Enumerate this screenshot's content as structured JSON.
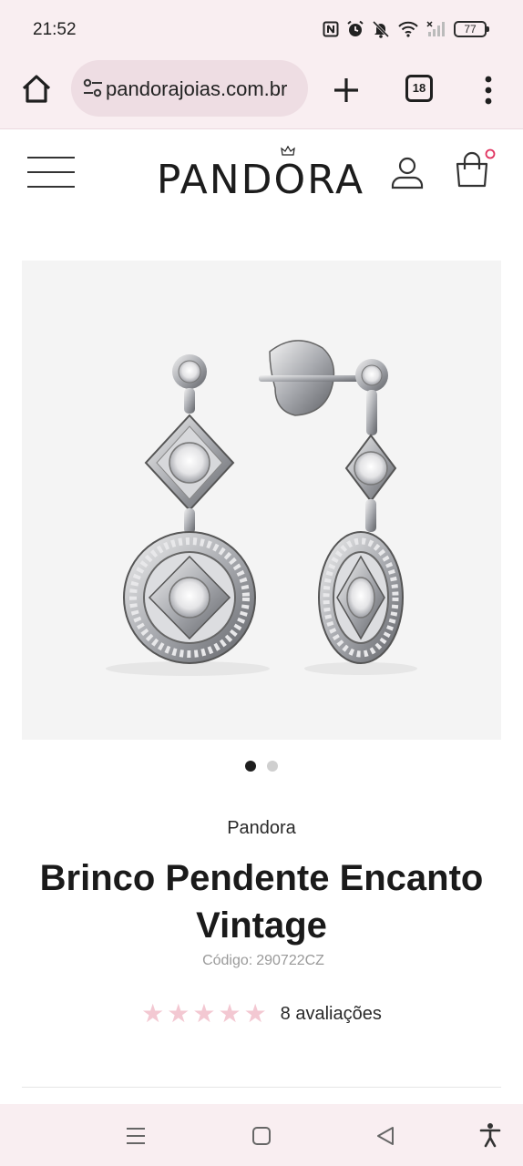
{
  "status_bar": {
    "time": "21:52",
    "battery": "77",
    "icons": [
      "nfc-icon",
      "alarm-icon",
      "mute-icon",
      "wifi-icon",
      "signal-icon",
      "battery-icon"
    ]
  },
  "browser": {
    "url": "pandorajoias.com.br",
    "tab_count": "18",
    "icons": [
      "home-icon",
      "site-settings-icon",
      "new-tab-icon",
      "tabs-icon",
      "more-vert-icon"
    ]
  },
  "site_header": {
    "logo": "PANDORA",
    "icons": [
      "hamburger-icon",
      "crown-icon",
      "account-icon",
      "cart-icon"
    ]
  },
  "product": {
    "brand": "Pandora",
    "title": "Brinco Pendente Encanto Vintage",
    "code_label": "Código:",
    "code": "290722CZ",
    "rating_value": 5,
    "rating_max": 5,
    "reviews": "8 avaliações",
    "image_count": 2,
    "active_image": 1
  },
  "colors": {
    "browser_bg": "#f9eef1",
    "url_pill": "#eedde3",
    "star": "#f3c8d2",
    "cart_badge": "#e0335f",
    "image_bg": "#f4f4f4"
  },
  "nav_bar": {
    "icons": [
      "recents-icon",
      "home-square-icon",
      "back-icon",
      "accessibility-icon"
    ]
  }
}
